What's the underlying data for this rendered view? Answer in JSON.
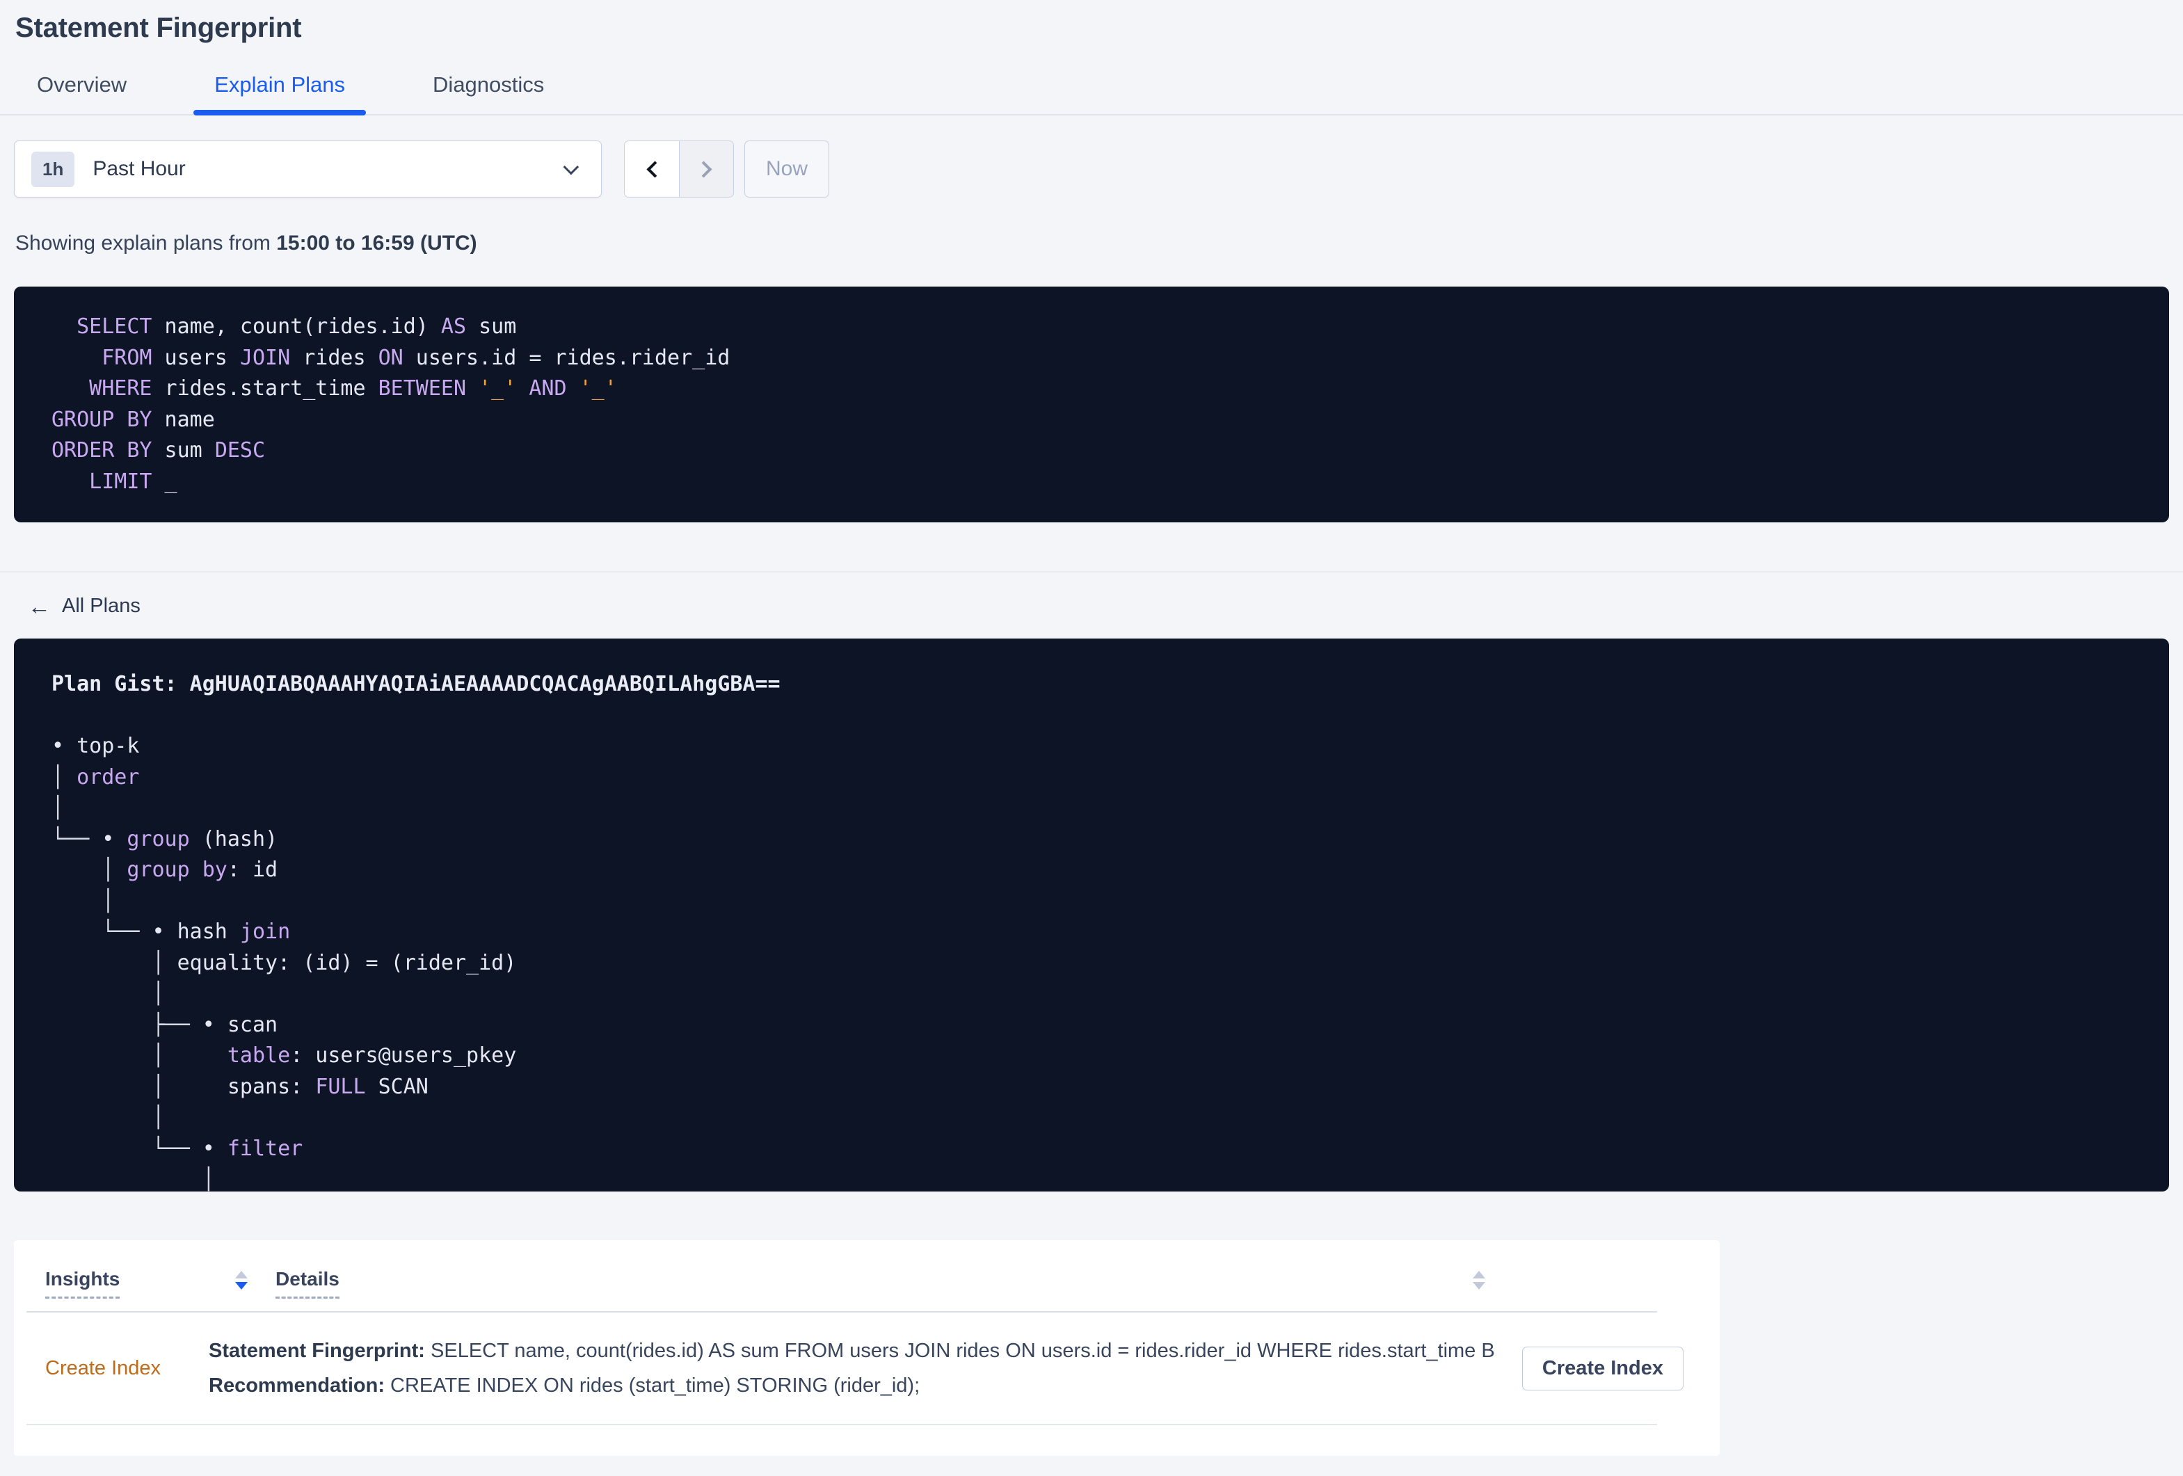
{
  "colors": {
    "accent_blue": "#1a5cf0",
    "insight_orange": "#bf6c1a",
    "code_background": "#0d1426",
    "code_keyword": "#c8a9f0",
    "code_text": "#e5e8f2",
    "code_literal": "#f0a23e",
    "page_background": "#f4f5f9"
  },
  "page": {
    "title": "Statement Fingerprint"
  },
  "tabs": [
    {
      "label": "Overview",
      "active": false
    },
    {
      "label": "Explain Plans",
      "active": true
    },
    {
      "label": "Diagnostics",
      "active": false
    }
  ],
  "time_picker": {
    "range_badge": "1h",
    "range_label": "Past Hour",
    "now_label": "Now"
  },
  "showing": {
    "prefix": "Showing explain plans from ",
    "range": "15:00 to 16:59 (UTC)"
  },
  "sql_box": {
    "lines": [
      [
        {
          "t": "kw",
          "x": "  SELECT"
        },
        {
          "t": "id",
          "x": " name, count(rides.id) "
        },
        {
          "t": "kw",
          "x": "AS"
        },
        {
          "t": "id",
          "x": " sum"
        }
      ],
      [
        {
          "t": "kw",
          "x": "    FROM"
        },
        {
          "t": "id",
          "x": " users "
        },
        {
          "t": "kw",
          "x": "JOIN"
        },
        {
          "t": "id",
          "x": " rides "
        },
        {
          "t": "kw",
          "x": "ON"
        },
        {
          "t": "id",
          "x": " users.id = rides.rider_id"
        }
      ],
      [
        {
          "t": "kw",
          "x": "   WHERE"
        },
        {
          "t": "id",
          "x": " rides.start_time "
        },
        {
          "t": "kw",
          "x": "BETWEEN"
        },
        {
          "t": "id",
          "x": " "
        },
        {
          "t": "lit",
          "x": "'_'"
        },
        {
          "t": "id",
          "x": " "
        },
        {
          "t": "kw",
          "x": "AND"
        },
        {
          "t": "id",
          "x": " "
        },
        {
          "t": "lit",
          "x": "'_'"
        }
      ],
      [
        {
          "t": "kw",
          "x": "GROUP BY"
        },
        {
          "t": "id",
          "x": " name"
        }
      ],
      [
        {
          "t": "kw",
          "x": "ORDER BY"
        },
        {
          "t": "id",
          "x": " sum "
        },
        {
          "t": "kw",
          "x": "DESC"
        }
      ],
      [
        {
          "t": "kw",
          "x": "   LIMIT"
        },
        {
          "t": "id",
          "x": " _"
        }
      ]
    ]
  },
  "plans_nav": {
    "back_arrow": "←",
    "label": "All Plans"
  },
  "plan_gist_box": {
    "lines": [
      [
        {
          "t": "st",
          "x": "Plan Gist: AgHUAQIABQAAAHYAQIAiAEAAAADCQACAgAABQILAhgGBA=="
        }
      ],
      [
        {
          "t": "tr",
          "x": ""
        }
      ],
      [
        {
          "t": "bl",
          "x": "• "
        },
        {
          "t": "id",
          "x": "top-k"
        }
      ],
      [
        {
          "t": "tr",
          "x": "│ "
        },
        {
          "t": "kw",
          "x": "order"
        }
      ],
      [
        {
          "t": "tr",
          "x": "│"
        }
      ],
      [
        {
          "t": "tr",
          "x": "└── "
        },
        {
          "t": "bl",
          "x": "• "
        },
        {
          "t": "kw",
          "x": "group"
        },
        {
          "t": "id",
          "x": " (hash)"
        }
      ],
      [
        {
          "t": "tr",
          "x": "    │ "
        },
        {
          "t": "kw",
          "x": "group by"
        },
        {
          "t": "id",
          "x": ": id"
        }
      ],
      [
        {
          "t": "tr",
          "x": "    │"
        }
      ],
      [
        {
          "t": "tr",
          "x": "    └── "
        },
        {
          "t": "bl",
          "x": "• "
        },
        {
          "t": "id",
          "x": "hash "
        },
        {
          "t": "kw",
          "x": "join"
        }
      ],
      [
        {
          "t": "tr",
          "x": "        │ "
        },
        {
          "t": "id",
          "x": "equality: (id) = (rider_id)"
        }
      ],
      [
        {
          "t": "tr",
          "x": "        │"
        }
      ],
      [
        {
          "t": "tr",
          "x": "        ├── "
        },
        {
          "t": "bl",
          "x": "• "
        },
        {
          "t": "id",
          "x": "scan"
        }
      ],
      [
        {
          "t": "tr",
          "x": "        │     "
        },
        {
          "t": "kw",
          "x": "table"
        },
        {
          "t": "id",
          "x": ": users@users_pkey"
        }
      ],
      [
        {
          "t": "tr",
          "x": "        │     "
        },
        {
          "t": "id",
          "x": "spans: "
        },
        {
          "t": "kw",
          "x": "FULL"
        },
        {
          "t": "id",
          "x": " SCAN"
        }
      ],
      [
        {
          "t": "tr",
          "x": "        │"
        }
      ],
      [
        {
          "t": "tr",
          "x": "        └── "
        },
        {
          "t": "bl",
          "x": "• "
        },
        {
          "t": "kw",
          "x": "filter"
        }
      ],
      [
        {
          "t": "tr",
          "x": "            │"
        }
      ]
    ]
  },
  "insights_table": {
    "columns": [
      {
        "label": "Insights",
        "sort": "desc"
      },
      {
        "label": "Details",
        "sort": "none"
      }
    ],
    "row": {
      "insight": "Create Index",
      "fingerprint_label": "Statement Fingerprint:",
      "fingerprint_text": " SELECT name, count(rides.id) AS sum FROM users JOIN rides ON users.id = rides.rider_id WHERE rides.start_time BETWEEN '_…",
      "recommendation_label": "Recommendation:",
      "recommendation_text": " CREATE INDEX ON rides (start_time) STORING (rider_id);",
      "action_label": "Create Index"
    }
  }
}
